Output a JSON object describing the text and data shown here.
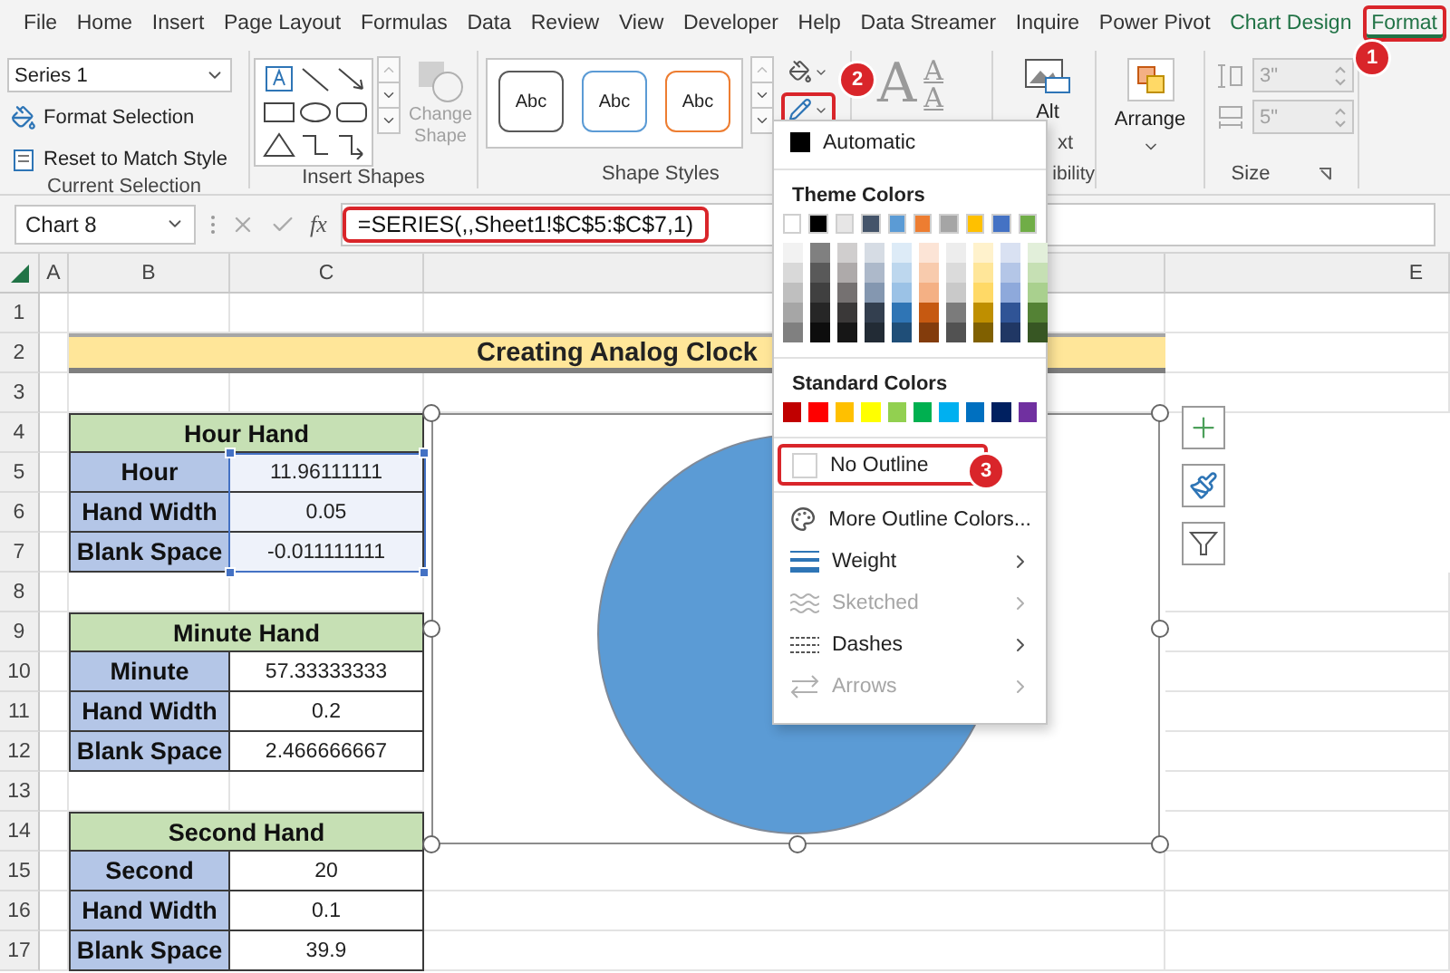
{
  "ribbon_tabs": [
    {
      "label": "File",
      "selected": false,
      "contextual": false,
      "callout": false
    },
    {
      "label": "Home",
      "selected": false,
      "contextual": false,
      "callout": false
    },
    {
      "label": "Insert",
      "selected": false,
      "contextual": false,
      "callout": false
    },
    {
      "label": "Page Layout",
      "selected": false,
      "contextual": false,
      "callout": false
    },
    {
      "label": "Formulas",
      "selected": false,
      "contextual": false,
      "callout": false
    },
    {
      "label": "Data",
      "selected": false,
      "contextual": false,
      "callout": false
    },
    {
      "label": "Review",
      "selected": false,
      "contextual": false,
      "callout": false
    },
    {
      "label": "View",
      "selected": false,
      "contextual": false,
      "callout": false
    },
    {
      "label": "Developer",
      "selected": false,
      "contextual": false,
      "callout": false
    },
    {
      "label": "Help",
      "selected": false,
      "contextual": false,
      "callout": false
    },
    {
      "label": "Data Streamer",
      "selected": false,
      "contextual": false,
      "callout": false
    },
    {
      "label": "Inquire",
      "selected": false,
      "contextual": false,
      "callout": false
    },
    {
      "label": "Power Pivot",
      "selected": false,
      "contextual": false,
      "callout": false
    },
    {
      "label": "Chart Design",
      "selected": false,
      "contextual": true,
      "callout": false
    },
    {
      "label": "Format",
      "selected": true,
      "contextual": true,
      "callout": true,
      "step": "1"
    }
  ],
  "current_selection": {
    "element": "Series 1",
    "buttons": [
      "Format Selection",
      "Reset to Match Style"
    ],
    "label": "Current Selection"
  },
  "insert_shapes": {
    "change_shape": {
      "label": "Change Shape",
      "disabled": true
    },
    "label": "Insert Shapes"
  },
  "shape_styles": {
    "presets": [
      {
        "label": "Abc",
        "color": "#595959"
      },
      {
        "label": "Abc",
        "color": "#5b9bd5"
      },
      {
        "label": "Abc",
        "color": "#ed7d31"
      }
    ],
    "outline_button": {
      "callout": true,
      "step": "2"
    },
    "label": "Shape Styles"
  },
  "wordart": {
    "quick_styles_glyph": "A",
    "text_fill_glyph": "A",
    "text_outline_glyph": "A"
  },
  "accessibility": {
    "button_parts": [
      "Alt",
      "xt"
    ],
    "label": "ibility"
  },
  "arrange": {
    "label": "Arrange"
  },
  "size": {
    "height": "3\"",
    "width": "5\"",
    "disabled": true,
    "label": "Size"
  },
  "formula_bar": {
    "name_box": "Chart 8",
    "function_label": "fx",
    "formula": "=SERIES(,,Sheet1!$C$5:$C$7,1)",
    "callout": true
  },
  "column_headers": [
    "A",
    "B",
    "C",
    "E"
  ],
  "row_numbers": [
    "1",
    "2",
    "3",
    "4",
    "5",
    "6",
    "7",
    "8",
    "9",
    "10",
    "11",
    "12",
    "13",
    "14",
    "15",
    "16",
    "17"
  ],
  "sheet_title": "Creating Analog Clock",
  "tables": [
    {
      "title": "Hour Hand",
      "selected": true,
      "rows": [
        {
          "label": "Hour",
          "value": "11.96111111"
        },
        {
          "label": "Hand Width",
          "value": "0.05"
        },
        {
          "label": "Blank Space",
          "value": "-0.011111111"
        }
      ]
    },
    {
      "title": "Minute Hand",
      "selected": false,
      "rows": [
        {
          "label": "Minute",
          "value": "57.33333333"
        },
        {
          "label": "Hand Width",
          "value": "0.2"
        },
        {
          "label": "Blank Space",
          "value": "2.466666667"
        }
      ]
    },
    {
      "title": "Second Hand",
      "selected": false,
      "rows": [
        {
          "label": "Second",
          "value": "20"
        },
        {
          "label": "Hand Width",
          "value": "0.1"
        },
        {
          "label": "Blank Space",
          "value": "39.9"
        }
      ]
    }
  ],
  "chart": {
    "selected": true
  },
  "outline_menu": {
    "automatic": "Automatic",
    "theme_header": "Theme Colors",
    "theme_colors": [
      {
        "color": "#ffffff",
        "shades": [
          {
            "color": "#f2f2f2"
          },
          {
            "color": "#d9d9d9"
          },
          {
            "color": "#bfbfbf"
          },
          {
            "color": "#a6a6a6"
          },
          {
            "color": "#808080"
          }
        ]
      },
      {
        "color": "#000000",
        "shades": [
          {
            "color": "#808080"
          },
          {
            "color": "#595959"
          },
          {
            "color": "#404040"
          },
          {
            "color": "#262626"
          },
          {
            "color": "#0d0d0d"
          }
        ]
      },
      {
        "color": "#e7e6e6",
        "shades": [
          {
            "color": "#d0cece"
          },
          {
            "color": "#aeaaaa"
          },
          {
            "color": "#757171"
          },
          {
            "color": "#3a3838"
          },
          {
            "color": "#161616"
          }
        ]
      },
      {
        "color": "#44546a",
        "shades": [
          {
            "color": "#d6dce4"
          },
          {
            "color": "#adb9ca"
          },
          {
            "color": "#8497b0"
          },
          {
            "color": "#333f4f"
          },
          {
            "color": "#222b35"
          }
        ]
      },
      {
        "color": "#5b9bd5",
        "shades": [
          {
            "color": "#ddebf7"
          },
          {
            "color": "#bdd7ee"
          },
          {
            "color": "#9bc2e6"
          },
          {
            "color": "#2f75b5"
          },
          {
            "color": "#1f4e78"
          }
        ]
      },
      {
        "color": "#ed7d31",
        "shades": [
          {
            "color": "#fce4d6"
          },
          {
            "color": "#f8cbad"
          },
          {
            "color": "#f4b084"
          },
          {
            "color": "#c65911"
          },
          {
            "color": "#833c0c"
          }
        ]
      },
      {
        "color": "#a5a5a5",
        "shades": [
          {
            "color": "#ededed"
          },
          {
            "color": "#dbdbdb"
          },
          {
            "color": "#c9c9c9"
          },
          {
            "color": "#7b7b7b"
          },
          {
            "color": "#525252"
          }
        ]
      },
      {
        "color": "#ffc000",
        "shades": [
          {
            "color": "#fff2cc"
          },
          {
            "color": "#ffe699"
          },
          {
            "color": "#ffd966"
          },
          {
            "color": "#bf8f00"
          },
          {
            "color": "#806000"
          }
        ]
      },
      {
        "color": "#4472c4",
        "shades": [
          {
            "color": "#d9e1f2"
          },
          {
            "color": "#b4c6e7"
          },
          {
            "color": "#8ea9db"
          },
          {
            "color": "#305496"
          },
          {
            "color": "#203764"
          }
        ]
      },
      {
        "color": "#70ad47",
        "shades": [
          {
            "color": "#e2efda"
          },
          {
            "color": "#c6e0b4"
          },
          {
            "color": "#a9d08e"
          },
          {
            "color": "#548235"
          },
          {
            "color": "#375623"
          }
        ]
      }
    ],
    "standard_header": "Standard Colors",
    "standard_colors": [
      {
        "color": "#c00000"
      },
      {
        "color": "#ff0000"
      },
      {
        "color": "#ffc000"
      },
      {
        "color": "#ffff00"
      },
      {
        "color": "#92d050"
      },
      {
        "color": "#00b050"
      },
      {
        "color": "#00b0f0"
      },
      {
        "color": "#0070c0"
      },
      {
        "color": "#002060"
      },
      {
        "color": "#7030a0"
      }
    ],
    "items": [
      {
        "kind": "no-outline",
        "label": "No Outline",
        "disabled": false,
        "submenu": false,
        "callout": true,
        "step": "3"
      },
      {
        "kind": "more-colors",
        "label": "More Outline Colors...",
        "disabled": false,
        "submenu": false,
        "callout": false
      },
      {
        "kind": "weight",
        "label": "Weight",
        "disabled": false,
        "submenu": true,
        "callout": false
      },
      {
        "kind": "sketched",
        "label": "Sketched",
        "disabled": true,
        "submenu": true,
        "callout": false
      },
      {
        "kind": "dashes",
        "label": "Dashes",
        "disabled": false,
        "submenu": true,
        "callout": false
      },
      {
        "kind": "arrows",
        "label": "Arrows",
        "disabled": true,
        "submenu": true,
        "callout": false
      }
    ]
  }
}
